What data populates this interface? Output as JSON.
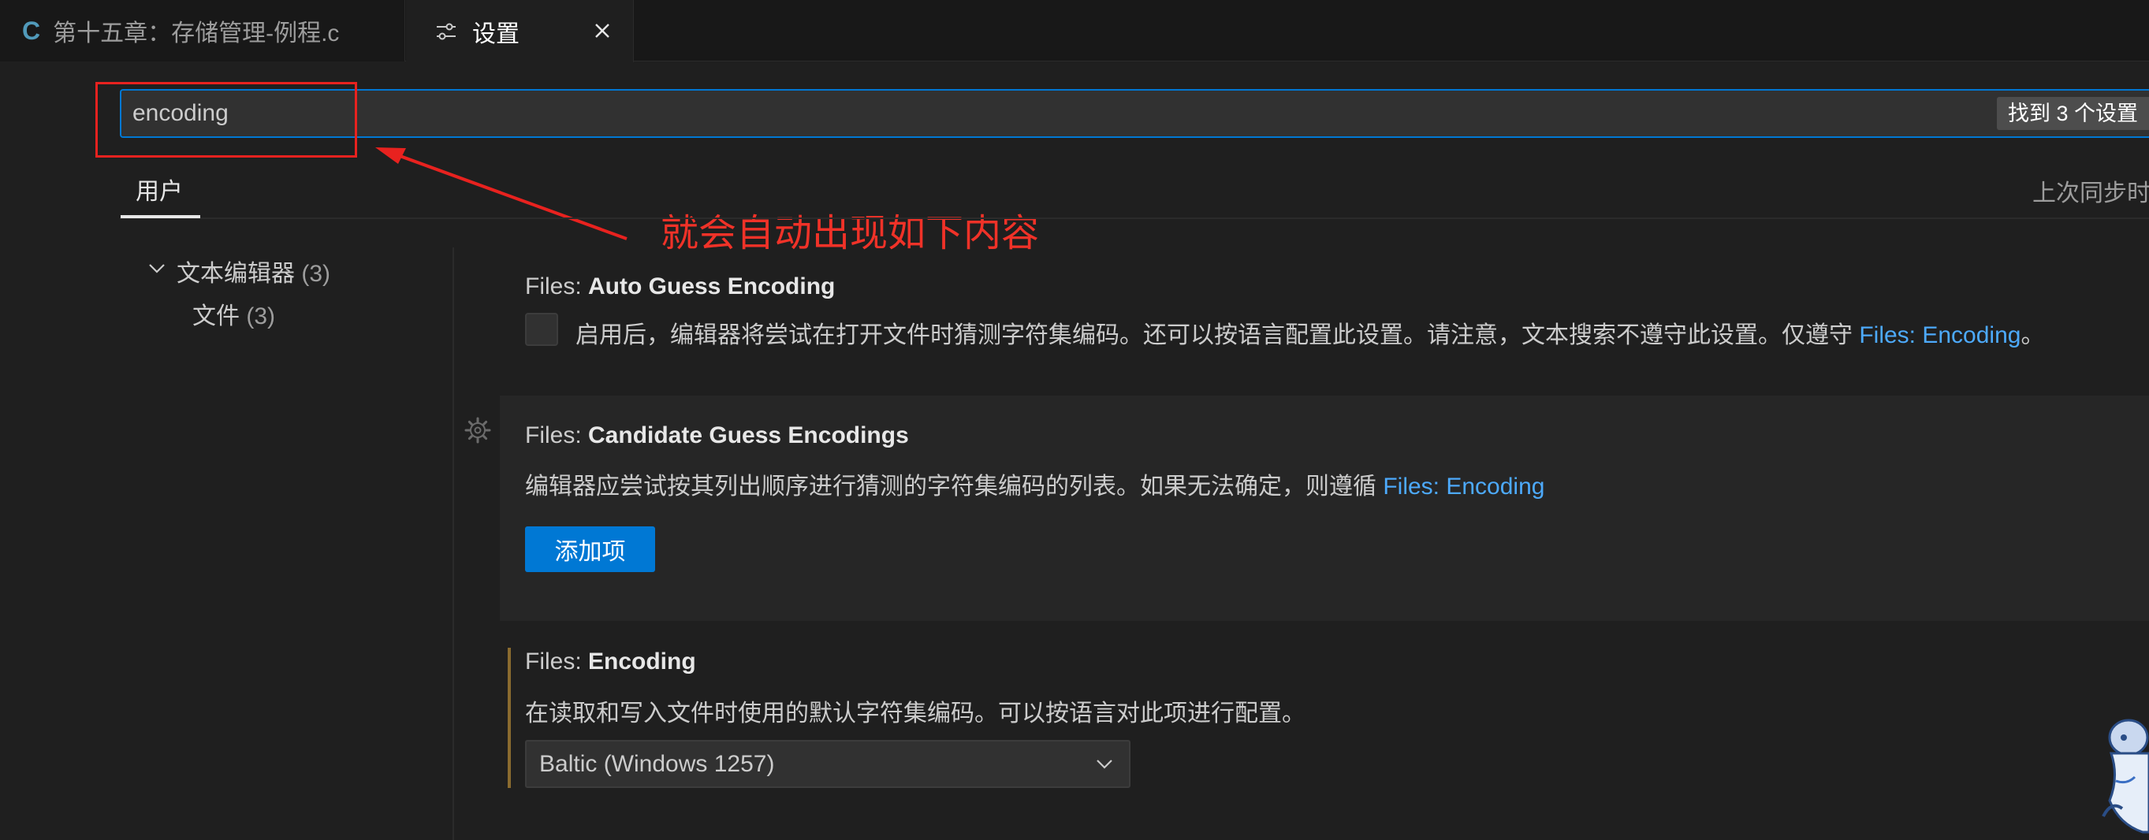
{
  "tabs": [
    {
      "icon": "c-file-icon",
      "icon_text": "C",
      "label": "第十五章：存储管理-例程.c"
    },
    {
      "icon": "settings-icon",
      "label": "设置",
      "close_icon": "close-icon"
    }
  ],
  "search": {
    "value": "encoding",
    "placeholder": "",
    "result_count": "找到 3 个设置"
  },
  "annotation": {
    "text": "就会自动出现如下内容",
    "color": "#f03228"
  },
  "scope": {
    "user_tab": "用户",
    "last_sync": "上次同步时间"
  },
  "toc": [
    {
      "label": "文本编辑器",
      "count": "(3)",
      "expanded": true
    },
    {
      "label": "文件",
      "count": "(3)"
    }
  ],
  "settings": {
    "auto_guess": {
      "category": "Files: ",
      "name": "Auto Guess Encoding",
      "checked": false,
      "description": "启用后，编辑器将尝试在打开文件时猜测字符集编码。还可以按语言配置此设置。请注意，文本搜索不遵守此设置。仅遵守 ",
      "link": "Files: Encoding",
      "suffix": "。"
    },
    "candidate": {
      "category": "Files: ",
      "name": "Candidate Guess Encodings",
      "description": "编辑器应尝试按其列出顺序进行猜测的字符集编码的列表。如果无法确定，则遵循 ",
      "link": "Files: Encoding",
      "add_button": "添加项"
    },
    "encoding": {
      "category": "Files: ",
      "name": "Encoding",
      "description": "在读取和写入文件时使用的默认字符集编码。可以按语言对此项进行配置。",
      "selected": "Baltic (Windows 1257)"
    }
  },
  "colors": {
    "accent": "#0078d4",
    "link": "#4daafc",
    "background": "#1f1f1f",
    "annotation_red": "#e8221f"
  }
}
